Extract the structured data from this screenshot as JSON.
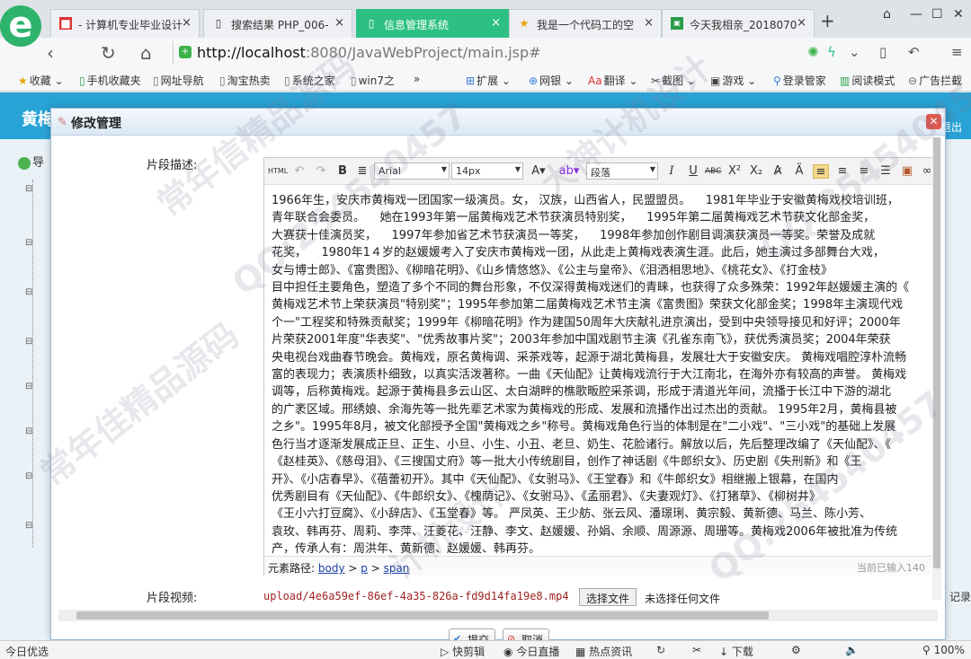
{
  "tabs": [
    {
      "label": "- 计算机专业毕业设计",
      "icon": "red-square-icon"
    },
    {
      "label": "搜索结果 PHP_006-",
      "icon": "page-icon"
    },
    {
      "label": "信息管理系统",
      "icon": "page-icon"
    },
    {
      "label": "我是一个代码工的空",
      "icon": "star-icon"
    },
    {
      "label": "今天我相亲_2018070",
      "icon": "green-site-icon"
    }
  ],
  "url": {
    "host": "http://localhost",
    "rest": ":8080/JavaWebProject/main.jsp#"
  },
  "bookmarks": [
    "收藏",
    "手机收藏夹",
    "网址导航",
    "淘宝热卖",
    "系统之家",
    "win7之",
    "»",
    "扩展",
    "网银",
    "翻译",
    "截图",
    "游戏",
    "登录管家",
    "阅读模式",
    "广告拦截"
  ],
  "app": {
    "title": "黄梅",
    "sidebar_item": "导",
    "right_label": "退出",
    "right_bottom_label": "记录"
  },
  "dialog": {
    "title": "修改管理",
    "desc_label": "片段描述:",
    "video_label": "片段视频:",
    "video_file": "upload/4e6a59ef-86ef-4a35-826a-fd9d14fa19e8.mp4",
    "choose_file": "选择文件",
    "no_file": "未选择任何文件",
    "submit": "提交",
    "cancel": "取消"
  },
  "editor": {
    "font": "Arial",
    "size": "14px",
    "block": "段落",
    "path_label": "元素路径:",
    "path": [
      "body",
      "p",
      "span"
    ],
    "count": "当前已输入140",
    "content": "1966年生，安庆市黄梅戏一团国家一级演员。女， 汉族，山西省人，民盟盟员。    1981年毕业于安徽黄梅戏校培训班，\n青年联合会委员。    她在1993年第一届黄梅戏艺术节获演员特别奖，    1995年第二届黄梅戏艺术节获文化部金奖，\n大赛获十佳演员奖，    1997年参加省艺术节获演员一等奖，    1998年参加创作剧目调演获演员一等奖。荣誉及成就\n花奖，    1980年1４岁的赵媛媛考入了安庆市黄梅戏一团，从此走上黄梅戏表演生涯。此后，她主演过多部舞台大戏，\n女与博士郎》、《富贵图》、《柳暗花明》、《山乡情悠悠》、《公主与皇帝》、《泪洒相思地》、《桃花女》、《打金枝》\n目中担任主要角色，塑造了多个不同的舞台形象，不仅深得黄梅戏迷们的青睐，也获得了众多殊荣：1992年赵媛媛主演的《\n黄梅戏艺术节上荣获演员\"特别奖\"；1995年参加第二届黄梅戏艺术节主演《富贵图》荣获文化部金奖；1998年主演现代戏\n个一\"工程奖和特殊贡献奖；1999年《柳暗花明》作为建国50周年大庆献礼进京演出，受到中央领导接见和好评；2000年\n片荣获2001年度\"华表奖\"、\"优秀故事片奖\"；2003年参加中国戏剧节主演《孔雀东南飞》，获优秀演员奖；2004年荣获\n央电视台戏曲春节晚会。黄梅戏，原名黄梅调、采茶戏等，起源于湖北黄梅县，发展壮大于安徽安庆。 黄梅戏唱腔淳朴流畅\n富的表现力；表演质朴细致，以真实活泼著称。一曲《天仙配》让黄梅戏流行于大江南北，在海外亦有较高的声誉。 黄梅戏\n调等，后称黄梅戏。起源于黄梅县多云山区、太白湖畔的樵歌畈腔采茶调，形成于清道光年间，流播于长江中下游的湖北\n的广袤区域。邢绣娘、余海先等一批先辈艺术家为黄梅戏的形成、发展和流播作出过杰出的贡献。 1995年2月，黄梅县被\n之乡\"。1995年8月，被文化部授予全国\"黄梅戏之乡\"称号。黄梅戏角色行当的体制是在\"二小戏\"、\"三小戏\"的基础上发展\n色行当才逐渐发展成正旦、正生、小旦、小生、小丑、老旦、奶生、花脸诸行。解放以后，先后整理改编了《天仙配》、《\n《赵桂英》、《慈母泪》、《三搜国丈府》等一批大小传统剧目，创作了神话剧《牛郎织女》、历史剧《失刑新》和《王\n开》、《小店春早》、《蓓蕾初开》。其中《天仙配》、《女驸马》、《王堂春》和《牛郎织女》相继搬上银幕，在国内\n优秀剧目有《天仙配》、《牛郎织女》、《槐荫记》、《女驸马》、《孟丽君》、《夫妻观灯》、《打猪草》、《柳树井》\n《王小六打豆腐》、《小辞店》、《玉堂春》等。 严凤英、王少舫、张云风、潘璟琍、黄宗毅、黄新德、马兰、陈小芳、\n袁玫、韩再芬、周莉、李萍、汪菱花、汪静、李文、赵媛媛、孙娟、余顺、周源源、周珊等。黄梅戏2006年被批准为传统\n产，传承人有：周洪年、黄新德、赵媛媛、韩再芬。"
  },
  "status": {
    "left": "今日优选",
    "items": [
      "快剪辑",
      "今日直播",
      "热点资讯",
      "下载",
      "100%"
    ]
  },
  "watermarks": [
    "常年信精品源码",
    "QQ:254540457",
    "大神计机设计",
    "QQ:25454045",
    "常年佳精品源码",
    "计机设计"
  ]
}
